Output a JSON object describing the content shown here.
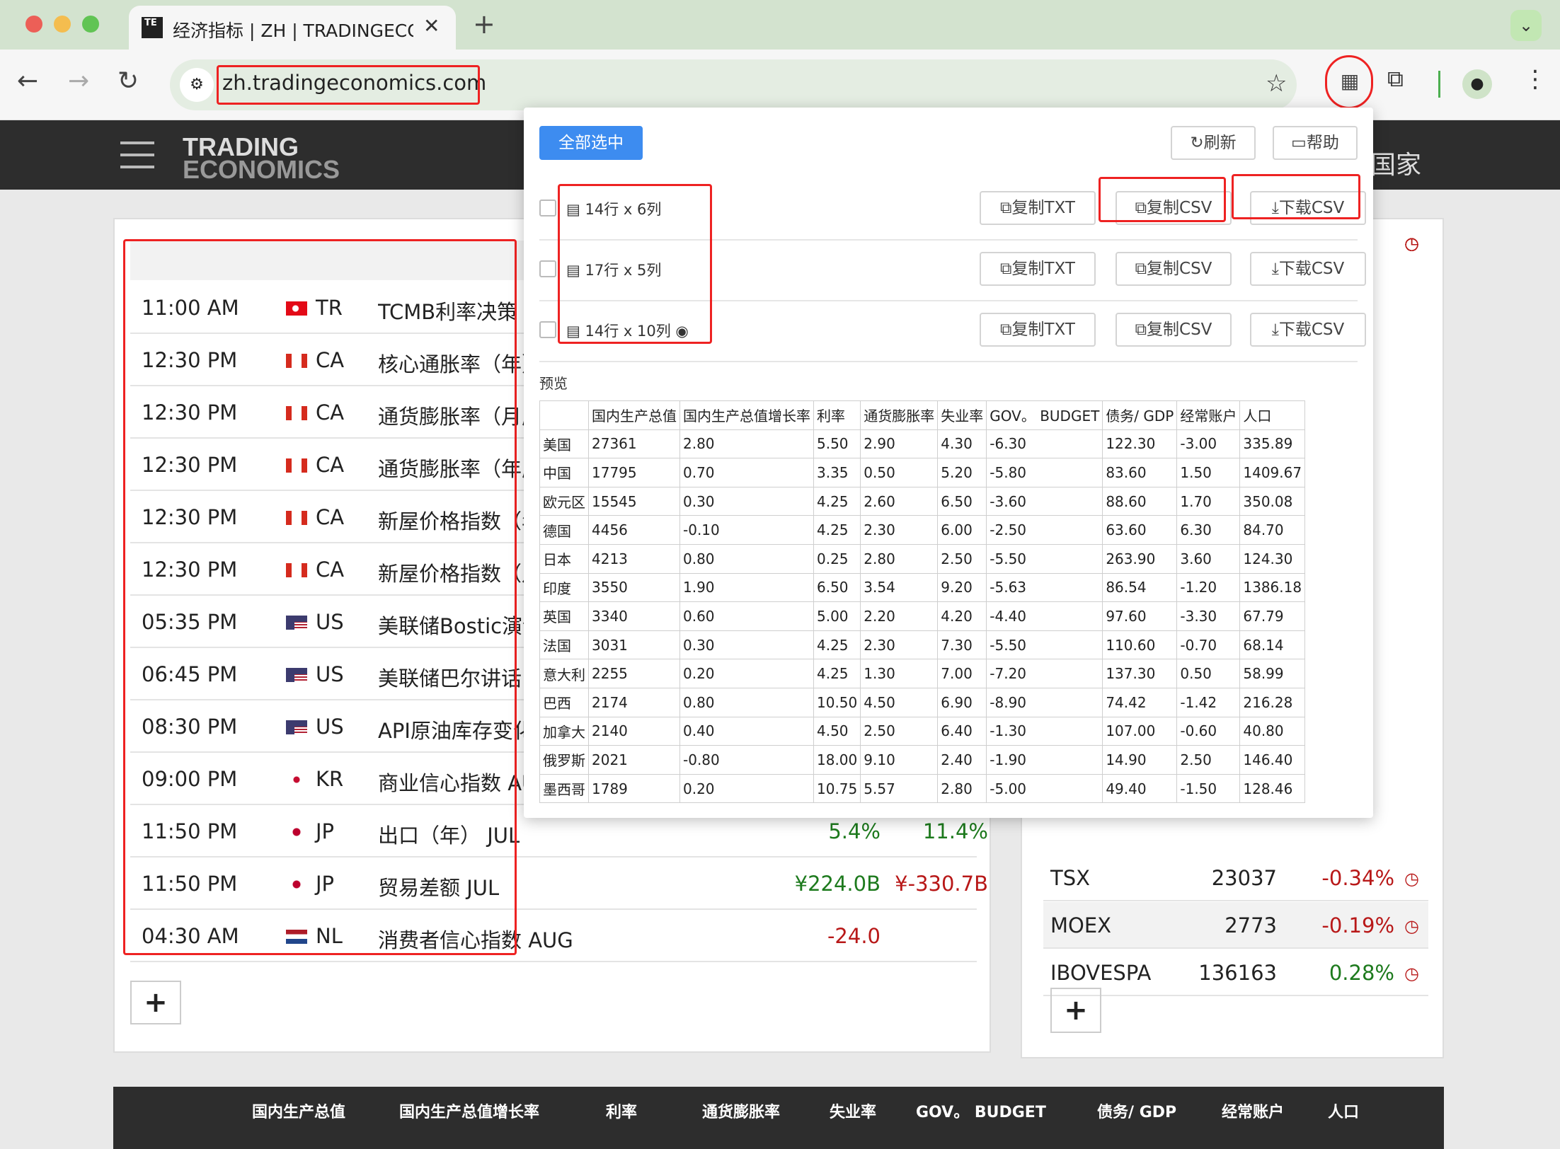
{
  "browser": {
    "tab_title": "经济指标 | ZH | TRADINGECONOMICS",
    "url": "zh.tradingeconomics.com",
    "favicon_text": "TE"
  },
  "site": {
    "logo_line1": "TRADING",
    "logo_line2": "ECONOMICS",
    "nav_right": "国家"
  },
  "calendar": [
    {
      "time": "11:00 AM",
      "flag": "tr",
      "code": "TR",
      "event": "TCMB利率决策",
      "actual": "",
      "forecast": ""
    },
    {
      "time": "12:30 PM",
      "flag": "ca",
      "code": "CA",
      "event": "核心通胀率（年）",
      "actual": "",
      "forecast": ""
    },
    {
      "time": "12:30 PM",
      "flag": "ca",
      "code": "CA",
      "event": "通货膨胀率（月度）",
      "actual": "",
      "forecast": ""
    },
    {
      "time": "12:30 PM",
      "flag": "ca",
      "code": "CA",
      "event": "通货膨胀率（年度）",
      "actual": "",
      "forecast": ""
    },
    {
      "time": "12:30 PM",
      "flag": "ca",
      "code": "CA",
      "event": "新屋价格指数（年）",
      "actual": "",
      "forecast": ""
    },
    {
      "time": "12:30 PM",
      "flag": "ca",
      "code": "CA",
      "event": "新屋价格指数（月）",
      "actual": "",
      "forecast": ""
    },
    {
      "time": "05:35 PM",
      "flag": "us",
      "code": "US",
      "event": "美联储Bostic演讲",
      "actual": "",
      "forecast": ""
    },
    {
      "time": "06:45 PM",
      "flag": "us",
      "code": "US",
      "event": "美联储巴尔讲话",
      "actual": "",
      "forecast": ""
    },
    {
      "time": "08:30 PM",
      "flag": "us",
      "code": "US",
      "event": "API原油库存变化",
      "actual": "",
      "forecast": ""
    },
    {
      "time": "09:00 PM",
      "flag": "kr",
      "code": "KR",
      "event": "商业信心指数 AUG",
      "actual": "",
      "forecast": ""
    },
    {
      "time": "11:50 PM",
      "flag": "jp",
      "code": "JP",
      "event": "出口（年） JUL",
      "actual": "5.4%",
      "forecast": "11.4%",
      "actual_color": "green",
      "forecast_color": "green"
    },
    {
      "time": "11:50 PM",
      "flag": "jp",
      "code": "JP",
      "event": "贸易差额 JUL",
      "actual": "¥224.0B",
      "forecast": "¥-330.7B",
      "actual_color": "green",
      "forecast_color": "red"
    },
    {
      "time": "04:30 AM",
      "flag": "nl",
      "code": "NL",
      "event": "消费者信心指数 AUG",
      "actual": "-24.0",
      "forecast": "",
      "actual_color": "red"
    }
  ],
  "markets": [
    {
      "name": "TSX",
      "price": "23037",
      "change": "-0.34%",
      "color": "red"
    },
    {
      "name": "MOEX",
      "price": "2773",
      "change": "-0.19%",
      "color": "red"
    },
    {
      "name": "IBOVESPA",
      "price": "136163",
      "change": "0.28%",
      "color": "green"
    }
  ],
  "plus_label": "+",
  "bottom_headers": [
    "国内生产总值",
    "国内生产总值增长率",
    "利率",
    "通货膨胀率",
    "失业率",
    "GOV。 BUDGET",
    "债务/ GDP",
    "经常账户",
    "人口"
  ],
  "popup": {
    "select_all": "全部选中",
    "refresh": "刷新",
    "help": "帮助",
    "tables": [
      {
        "label": "14行 x 6列"
      },
      {
        "label": "17行 x 5列"
      },
      {
        "label": "14行 x 10列"
      }
    ],
    "copy_txt": "复制TXT",
    "copy_csv": "复制CSV",
    "download_csv": "下载CSV",
    "preview_label": "预览",
    "preview_headers": [
      "",
      "国内生产总值",
      "国内生产总值增长率",
      "利率",
      "通货膨胀率",
      "失业率",
      "GOV。 BUDGET",
      "债务/ GDP",
      "经常账户",
      "人口"
    ],
    "preview_rows": [
      [
        "美国",
        "27361",
        "2.80",
        "5.50",
        "2.90",
        "4.30",
        "-6.30",
        "122.30",
        "-3.00",
        "335.89"
      ],
      [
        "中国",
        "17795",
        "0.70",
        "3.35",
        "0.50",
        "5.20",
        "-5.80",
        "83.60",
        "1.50",
        "1409.67"
      ],
      [
        "欧元区",
        "15545",
        "0.30",
        "4.25",
        "2.60",
        "6.50",
        "-3.60",
        "88.60",
        "1.70",
        "350.08"
      ],
      [
        "德国",
        "4456",
        "-0.10",
        "4.25",
        "2.30",
        "6.00",
        "-2.50",
        "63.60",
        "6.30",
        "84.70"
      ],
      [
        "日本",
        "4213",
        "0.80",
        "0.25",
        "2.80",
        "2.50",
        "-5.50",
        "263.90",
        "3.60",
        "124.30"
      ],
      [
        "印度",
        "3550",
        "1.90",
        "6.50",
        "3.54",
        "9.20",
        "-5.63",
        "86.54",
        "-1.20",
        "1386.18"
      ],
      [
        "英国",
        "3340",
        "0.60",
        "5.00",
        "2.20",
        "4.20",
        "-4.40",
        "97.60",
        "-3.30",
        "67.79"
      ],
      [
        "法国",
        "3031",
        "0.30",
        "4.25",
        "2.30",
        "7.30",
        "-5.50",
        "110.60",
        "-0.70",
        "68.14"
      ],
      [
        "意大利",
        "2255",
        "0.20",
        "4.25",
        "1.30",
        "7.00",
        "-7.20",
        "137.30",
        "0.50",
        "58.99"
      ],
      [
        "巴西",
        "2174",
        "0.80",
        "10.50",
        "4.50",
        "6.90",
        "-8.90",
        "74.42",
        "-1.42",
        "216.28"
      ],
      [
        "加拿大",
        "2140",
        "0.40",
        "4.50",
        "2.50",
        "6.40",
        "-1.30",
        "107.00",
        "-0.60",
        "40.80"
      ],
      [
        "俄罗斯",
        "2021",
        "-0.80",
        "18.00",
        "9.10",
        "2.40",
        "-1.90",
        "14.90",
        "2.50",
        "146.40"
      ],
      [
        "墨西哥",
        "1789",
        "0.20",
        "10.75",
        "5.57",
        "2.80",
        "-5.00",
        "49.40",
        "-1.50",
        "128.46"
      ]
    ]
  }
}
